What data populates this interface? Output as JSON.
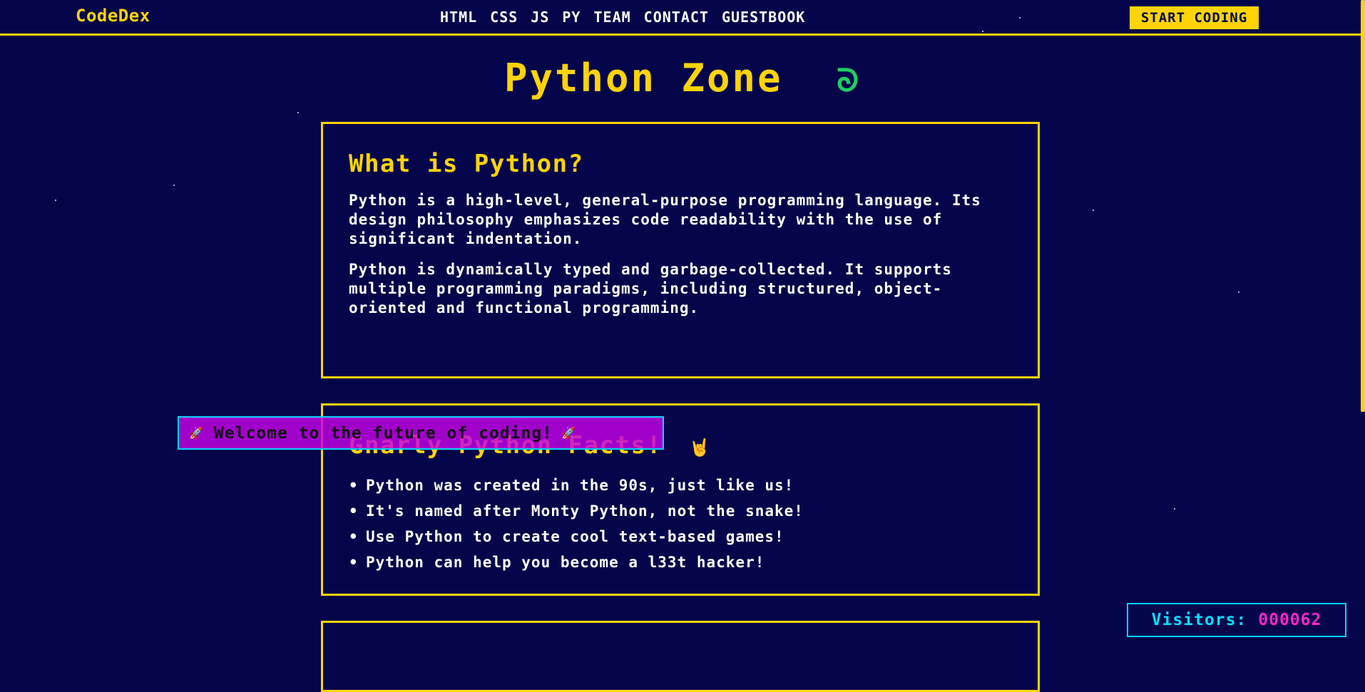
{
  "navbar": {
    "logo": "CodeDex",
    "links": [
      {
        "label": "HTML"
      },
      {
        "label": "CSS"
      },
      {
        "label": "JS"
      },
      {
        "label": "PY"
      },
      {
        "label": "TEAM"
      },
      {
        "label": "CONTACT"
      },
      {
        "label": "GUESTBOOK"
      }
    ],
    "cta_label": "START CODING"
  },
  "hero": {
    "title": "Python Zone",
    "icon": "snake-icon"
  },
  "about_card": {
    "title": "What is Python?",
    "paragraphs": [
      "Python is a high-level, general-purpose programming language. Its design philosophy emphasizes code readability with the use of significant indentation.",
      "Python is dynamically typed and garbage-collected. It supports multiple programming paradigms, including structured, object-oriented and functional programming."
    ]
  },
  "facts_card": {
    "title": "Gnarly Python Facts!",
    "title_icon": "rock-hand-icon",
    "items": [
      "Python was created in the 90s, just like us!",
      "It's named after Monty Python, not the snake!",
      "Use Python to create cool text-based games!",
      "Python can help you become a l33t hacker!"
    ]
  },
  "banner": {
    "text": "Welcome to the future of coding!",
    "icon": "rocket-icon"
  },
  "visitor_counter": {
    "label": "Visitors:",
    "value": "000062"
  },
  "colors": {
    "background": "#03044a",
    "accent": "#ffd400",
    "banner": "#c400e8",
    "counter_label": "#00e1ff",
    "counter_value": "#ff24c8"
  }
}
